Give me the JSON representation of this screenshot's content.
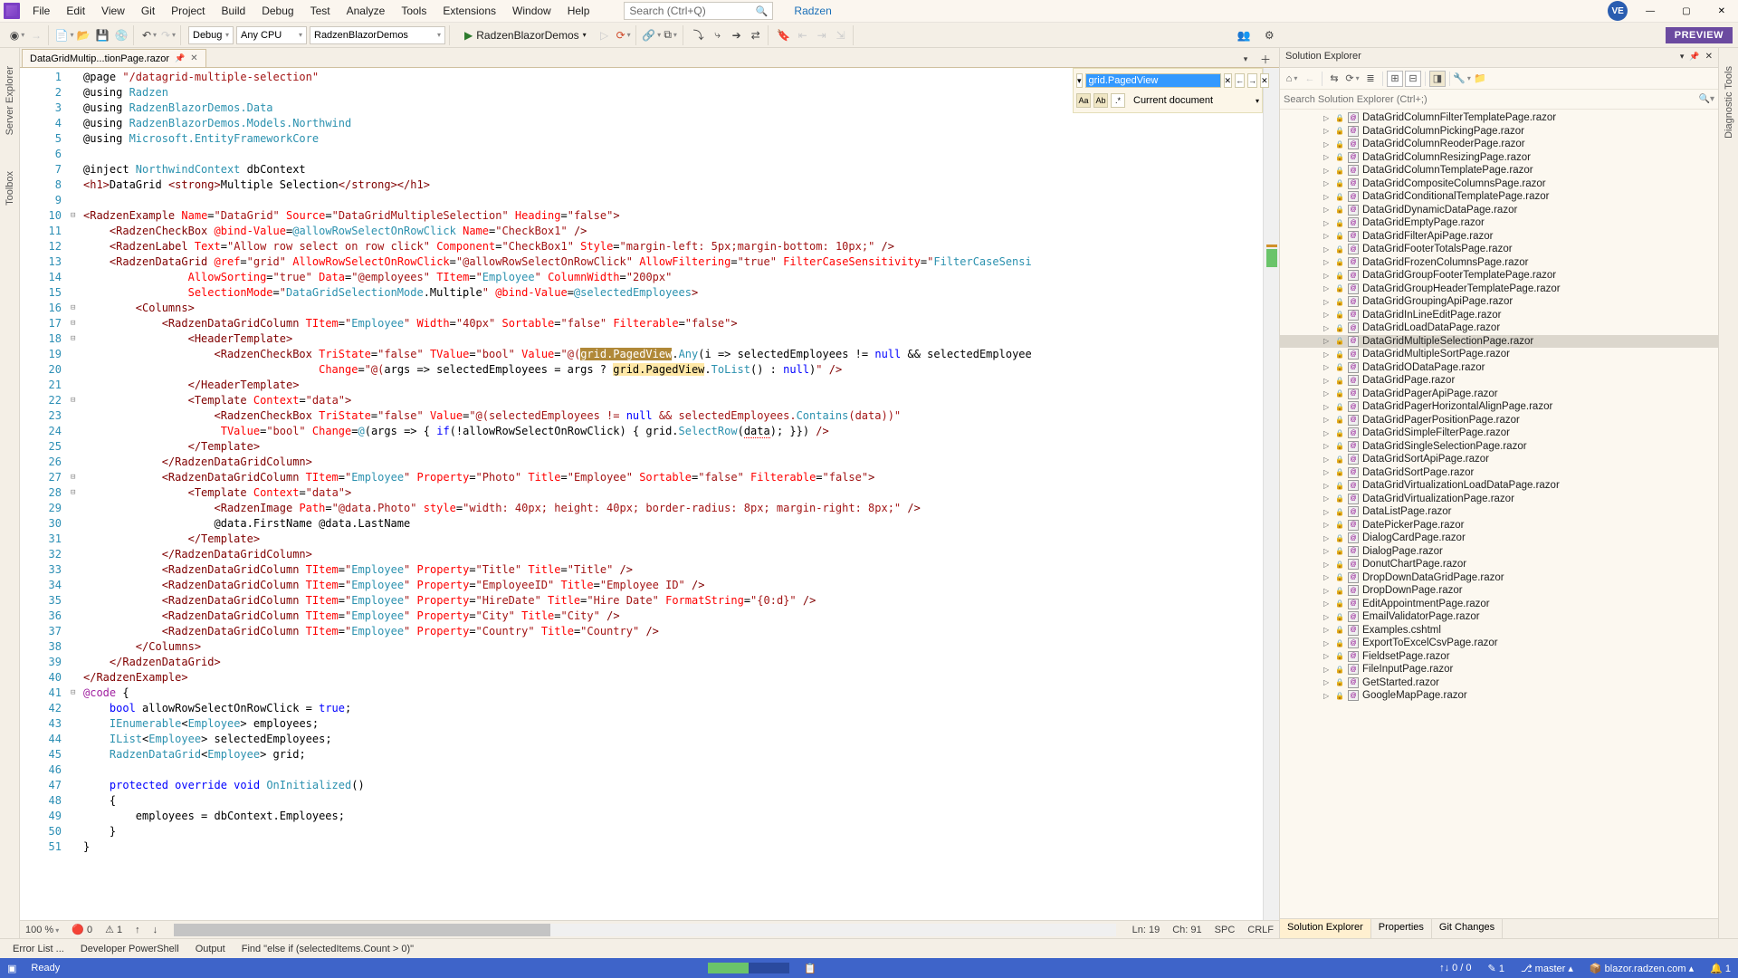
{
  "menus": [
    "File",
    "Edit",
    "View",
    "Git",
    "Project",
    "Build",
    "Debug",
    "Test",
    "Analyze",
    "Tools",
    "Extensions",
    "Window",
    "Help"
  ],
  "searchPlaceholder": "Search (Ctrl+Q)",
  "solutionName": "Radzen",
  "avatar": "VE",
  "config": {
    "debug": "Debug",
    "cpu": "Any CPU",
    "project": "RadzenBlazorDemos",
    "start": "RadzenBlazorDemos"
  },
  "previewBtn": "PREVIEW",
  "leftTabs": [
    "Server Explorer",
    "Toolbox"
  ],
  "rightTabs": [
    "Diagnostic Tools"
  ],
  "tab": {
    "name": "DataGridMultip...tionPage.razor"
  },
  "find": {
    "text": "grid.PagedView",
    "scope": "Current document"
  },
  "code": [
    {
      "n": 1,
      "h": "@page <s>\"/datagrid-multiple-selection\"</s>"
    },
    {
      "n": 2,
      "h": "@using <t>Radzen</t>"
    },
    {
      "n": 3,
      "h": "@using <t>RadzenBlazorDemos.Data</t>"
    },
    {
      "n": 4,
      "h": "@using <t>RadzenBlazorDemos.Models.Northwind</t>"
    },
    {
      "n": 5,
      "h": "@using <t>Microsoft.EntityFrameworkCore</t>"
    },
    {
      "n": 6,
      "h": ""
    },
    {
      "n": 7,
      "h": "@inject <t>NorthwindContext</t> dbContext"
    },
    {
      "n": 8,
      "h": "<g>&lt;h1&gt;</g>DataGrid <g>&lt;strong&gt;</g>Multiple Selection<g>&lt;/strong&gt;&lt;/h1&gt;</g>"
    },
    {
      "n": 9,
      "h": ""
    },
    {
      "n": 10,
      "h": "<g>&lt;RadzenExample</g> <a>Name</a>=<s>\"DataGrid\"</s> <a>Source</a>=<s>\"DataGridMultipleSelection\"</s> <a>Heading</a>=<s>\"false\"</s><g>&gt;</g>",
      "f": "⊟"
    },
    {
      "n": 11,
      "h": "    <g>&lt;RadzenCheckBox</g> <a>@bind-Value</a>=<t>@allowRowSelectOnRowClick</t> <a>Name</a>=<s>\"CheckBox1\"</s> <g>/&gt;</g>"
    },
    {
      "n": 12,
      "h": "    <g>&lt;RadzenLabel</g> <a>Text</a>=<s>\"Allow row select on row click\"</s> <a>Component</a>=<s>\"CheckBox1\"</s> <a>Style</a>=<s>\"margin-left: 5px;margin-bottom: 10px;\"</s> <g>/&gt;</g>"
    },
    {
      "n": 13,
      "h": "    <g>&lt;RadzenDataGrid</g> <a>@ref</a>=<s>\"grid\"</s> <a>AllowRowSelectOnRowClick</a>=<s>\"@allowRowSelectOnRowClick\"</s> <a>AllowFiltering</a>=<s>\"true\"</s> <a>FilterCaseSensitivity</a>=<s>\"</s><t>FilterCaseSensi</t>"
    },
    {
      "n": 14,
      "h": "                <a>AllowSorting</a>=<s>\"true\"</s> <a>Data</a>=<s>\"@employees\"</s> <a>TItem</a>=<s>\"</s><t>Employee</t><s>\"</s> <a>ColumnWidth</a>=<s>\"200px\"</s>"
    },
    {
      "n": 15,
      "h": "                <a>SelectionMode</a>=<s>\"</s><t>DataGridSelectionMode</t>.Multiple<s>\"</s> <a>@bind-Value</a>=<t>@selectedEmployees</t><g>&gt;</g>"
    },
    {
      "n": 16,
      "h": "        <g>&lt;Columns&gt;</g>",
      "f": "⊟"
    },
    {
      "n": 17,
      "h": "            <g>&lt;RadzenDataGridColumn</g> <a>TItem</a>=<s>\"</s><t>Employee</t><s>\"</s> <a>Width</a>=<s>\"40px\"</s> <a>Sortable</a>=<s>\"false\"</s> <a>Filterable</a>=<s>\"false\"</s><g>&gt;</g>",
      "f": "⊟"
    },
    {
      "n": 18,
      "h": "                <g>&lt;HeaderTemplate&gt;</g>",
      "f": "⊟"
    },
    {
      "n": 19,
      "h": "                    <g>&lt;RadzenCheckBox</g> <a>TriState</a>=<s>\"false\"</s> <a>TValue</a>=<s>\"bool\"</s> <a>Value</a>=<s>\"@(</s><hlsel>grid.PagedView</hlsel>.<t>Any</t>(i =&gt; selectedEmployees != <k>null</k> &amp;&amp; selectedEmployee",
      "bar": true
    },
    {
      "n": 20,
      "h": "                                    <a>Change</a>=<s>\"@(</s>args =&gt; selectedEmployees = args ? <hl>grid.PagedView</hl>.<t>ToList</t>() : <k>null</k>)<s>\"</s> <g>/&gt;</g>",
      "bar": true
    },
    {
      "n": 21,
      "h": "                <g>&lt;/HeaderTemplate&gt;</g>",
      "bar": true
    },
    {
      "n": 22,
      "h": "                <g>&lt;Template</g> <a>Context</a>=<s>\"data\"</s><g>&gt;</g>",
      "f": "⊟"
    },
    {
      "n": 23,
      "h": "                    <g>&lt;RadzenCheckBox</g> <a>TriState</a>=<s>\"false\"</s> <a>Value</a>=<s>\"@(selectedEmployees != </s><k>null</k><s> &amp;&amp; selectedEmployees.</s><t>Contains</t><s>(data))\"</s>"
    },
    {
      "n": 24,
      "h": "                     <a>TValue</a>=<s>\"bool\"</s> <a>Change</a>=<t>@</t>(args =&gt; { <k>if</k>(!allowRowSelectOnRowClick) { grid.<t>SelectRow</t>(<u>data</u>); }}) <g>/&gt;</g>"
    },
    {
      "n": 25,
      "h": "                <g>&lt;/Template&gt;</g>"
    },
    {
      "n": 26,
      "h": "            <g>&lt;/RadzenDataGridColumn&gt;</g>"
    },
    {
      "n": 27,
      "h": "            <g>&lt;RadzenDataGridColumn</g> <a>TItem</a>=<s>\"</s><t>Employee</t><s>\"</s> <a>Property</a>=<s>\"Photo\"</s> <a>Title</a>=<s>\"Employee\"</s> <a>Sortable</a>=<s>\"false\"</s> <a>Filterable</a>=<s>\"false\"</s><g>&gt;</g>",
      "f": "⊟"
    },
    {
      "n": 28,
      "h": "                <g>&lt;Template</g> <a>Context</a>=<s>\"data\"</s><g>&gt;</g>",
      "f": "⊟"
    },
    {
      "n": 29,
      "h": "                    <g>&lt;RadzenImage</g> <a>Path</a>=<s>\"@data.Photo\"</s> <a>style</a>=<s>\"width: 40px; height: 40px; border-radius: 8px; margin-right: 8px;\"</s> <g>/&gt;</g>"
    },
    {
      "n": 30,
      "h": "                    @data.FirstName @data.LastName"
    },
    {
      "n": 31,
      "h": "                <g>&lt;/Template&gt;</g>"
    },
    {
      "n": 32,
      "h": "            <g>&lt;/RadzenDataGridColumn&gt;</g>"
    },
    {
      "n": 33,
      "h": "            <g>&lt;RadzenDataGridColumn</g> <a>TItem</a>=<s>\"</s><t>Employee</t><s>\"</s> <a>Property</a>=<s>\"Title\"</s> <a>Title</a>=<s>\"Title\"</s> <g>/&gt;</g>"
    },
    {
      "n": 34,
      "h": "            <g>&lt;RadzenDataGridColumn</g> <a>TItem</a>=<s>\"</s><t>Employee</t><s>\"</s> <a>Property</a>=<s>\"EmployeeID\"</s> <a>Title</a>=<s>\"Employee ID\"</s> <g>/&gt;</g>"
    },
    {
      "n": 35,
      "h": "            <g>&lt;RadzenDataGridColumn</g> <a>TItem</a>=<s>\"</s><t>Employee</t><s>\"</s> <a>Property</a>=<s>\"HireDate\"</s> <a>Title</a>=<s>\"Hire Date\"</s> <a>FormatString</a>=<s>\"{0:d}\"</s> <g>/&gt;</g>"
    },
    {
      "n": 36,
      "h": "            <g>&lt;RadzenDataGridColumn</g> <a>TItem</a>=<s>\"</s><t>Employee</t><s>\"</s> <a>Property</a>=<s>\"City\"</s> <a>Title</a>=<s>\"City\"</s> <g>/&gt;</g>"
    },
    {
      "n": 37,
      "h": "            <g>&lt;RadzenDataGridColumn</g> <a>TItem</a>=<s>\"</s><t>Employee</t><s>\"</s> <a>Property</a>=<s>\"Country\"</s> <a>Title</a>=<s>\"Country\"</s> <g>/&gt;</g>"
    },
    {
      "n": 38,
      "h": "        <g>&lt;/Columns&gt;</g>"
    },
    {
      "n": 39,
      "h": "    <g>&lt;/RadzenDataGrid&gt;</g>"
    },
    {
      "n": 40,
      "h": "<g>&lt;/RadzenExample&gt;</g>"
    },
    {
      "n": 41,
      "h": "<d>@code</d> {",
      "f": "⊟"
    },
    {
      "n": 42,
      "h": "    <k>bool</k> allowRowSelectOnRowClick = <k>true</k>;"
    },
    {
      "n": 43,
      "h": "    <t>IEnumerable</t>&lt;<t>Employee</t>&gt; employees;"
    },
    {
      "n": 44,
      "h": "    <t>IList</t>&lt;<t>Employee</t>&gt; selectedEmployees;"
    },
    {
      "n": 45,
      "h": "    <t>RadzenDataGrid</t>&lt;<t>Employee</t>&gt; grid;"
    },
    {
      "n": 46,
      "h": ""
    },
    {
      "n": 47,
      "h": "    <k>protected override void</k> <t>OnInitialized</t>()"
    },
    {
      "n": 48,
      "h": "    {"
    },
    {
      "n": 49,
      "h": "        employees = dbContext.Employees;"
    },
    {
      "n": 50,
      "h": "    }"
    },
    {
      "n": 51,
      "h": "}"
    }
  ],
  "editorStatus": {
    "zoom": "100 %",
    "errors": "0",
    "warnings": "1",
    "pos": "Ln: 19",
    "ch": "Ch: 91",
    "spc": "SPC",
    "crlf": "CRLF"
  },
  "bottomTabs": [
    "Error List ...",
    "Developer PowerShell",
    "Output",
    "Find \"else if (selectedItems.Count > 0)\""
  ],
  "solExp": {
    "title": "Solution Explorer",
    "search": "Search Solution Explorer (Ctrl+;)",
    "tabs": [
      "Solution Explorer",
      "Properties",
      "Git Changes"
    ],
    "activeTab": 0,
    "selected": "DataGridMultipleSelectionPage.razor",
    "items": [
      "DataGridColumnFilterTemplatePage.razor",
      "DataGridColumnPickingPage.razor",
      "DataGridColumnReoderPage.razor",
      "DataGridColumnResizingPage.razor",
      "DataGridColumnTemplatePage.razor",
      "DataGridCompositeColumnsPage.razor",
      "DataGridConditionalTemplatePage.razor",
      "DataGridDynamicDataPage.razor",
      "DataGridEmptyPage.razor",
      "DataGridFilterApiPage.razor",
      "DataGridFooterTotalsPage.razor",
      "DataGridFrozenColumnsPage.razor",
      "DataGridGroupFooterTemplatePage.razor",
      "DataGridGroupHeaderTemplatePage.razor",
      "DataGridGroupingApiPage.razor",
      "DataGridInLineEditPage.razor",
      "DataGridLoadDataPage.razor",
      "DataGridMultipleSelectionPage.razor",
      "DataGridMultipleSortPage.razor",
      "DataGridODataPage.razor",
      "DataGridPage.razor",
      "DataGridPagerApiPage.razor",
      "DataGridPagerHorizontalAlignPage.razor",
      "DataGridPagerPositionPage.razor",
      "DataGridSimpleFilterPage.razor",
      "DataGridSingleSelectionPage.razor",
      "DataGridSortApiPage.razor",
      "DataGridSortPage.razor",
      "DataGridVirtualizationLoadDataPage.razor",
      "DataGridVirtualizationPage.razor",
      "DataListPage.razor",
      "DatePickerPage.razor",
      "DialogCardPage.razor",
      "DialogPage.razor",
      "DonutChartPage.razor",
      "DropDownDataGridPage.razor",
      "DropDownPage.razor",
      "EditAppointmentPage.razor",
      "EmailValidatorPage.razor",
      "Examples.cshtml",
      "ExportToExcelCsvPage.razor",
      "FieldsetPage.razor",
      "FileInputPage.razor",
      "GetStarted.razor",
      "GoogleMapPage.razor"
    ]
  },
  "status": {
    "ready": "Ready",
    "gitcount": "0 / 0",
    "pending": "1",
    "branch": "master",
    "repo": "blazor.radzen.com",
    "bell": "1"
  }
}
